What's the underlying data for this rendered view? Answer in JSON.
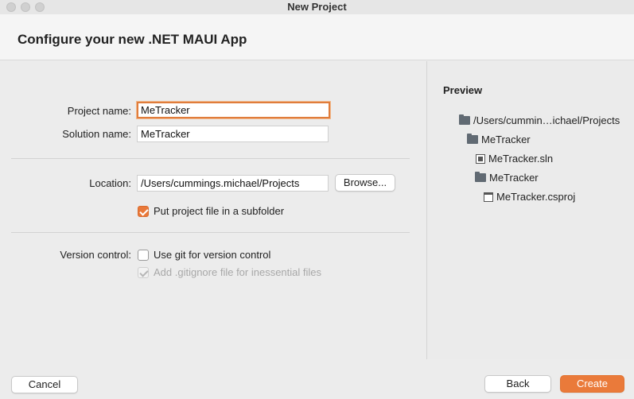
{
  "window": {
    "title": "New Project"
  },
  "header": {
    "title": "Configure your new .NET MAUI App"
  },
  "form": {
    "project_name_label": "Project name:",
    "project_name_value": "MeTracker",
    "solution_name_label": "Solution name:",
    "solution_name_value": "MeTracker",
    "location_label": "Location:",
    "location_value": "/Users/cummings.michael/Projects",
    "browse_label": "Browse...",
    "subfolder_label": "Put project file in a subfolder",
    "subfolder_checked": true,
    "version_control_label": "Version control:",
    "git_label": "Use git for version control",
    "git_checked": false,
    "gitignore_label": "Add .gitignore file for inessential files",
    "gitignore_checked": true,
    "gitignore_enabled": false
  },
  "preview": {
    "title": "Preview",
    "tree": [
      {
        "label": "/Users/cummin…ichael/Projects",
        "icon": "folder-icon"
      },
      {
        "label": "MeTracker",
        "icon": "folder-icon"
      },
      {
        "label": "MeTracker.sln",
        "icon": "solution-file-icon"
      },
      {
        "label": "MeTracker",
        "icon": "folder-icon"
      },
      {
        "label": "MeTracker.csproj",
        "icon": "project-file-icon"
      }
    ]
  },
  "footer": {
    "cancel_label": "Cancel",
    "back_label": "Back",
    "create_label": "Create"
  },
  "colors": {
    "accent": "#ea7a3a"
  }
}
